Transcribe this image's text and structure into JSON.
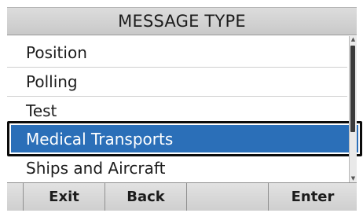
{
  "header": {
    "title": "MESSAGE TYPE"
  },
  "menu": {
    "items": [
      {
        "label": "Position"
      },
      {
        "label": "Polling"
      },
      {
        "label": "Test"
      },
      {
        "label": "Medical Transports",
        "selected": true
      },
      {
        "label": "Ships and Aircraft"
      }
    ]
  },
  "softkeys": {
    "k1": "Exit",
    "k2": "Back",
    "k3": "",
    "k4": "Enter"
  },
  "colors": {
    "selection": "#2b6fb8",
    "selection_text": "#ffffff",
    "frame": "#0b0b0b"
  },
  "icons": {
    "scroll_up": "triangle-up-icon",
    "scroll_down": "triangle-down-icon"
  }
}
